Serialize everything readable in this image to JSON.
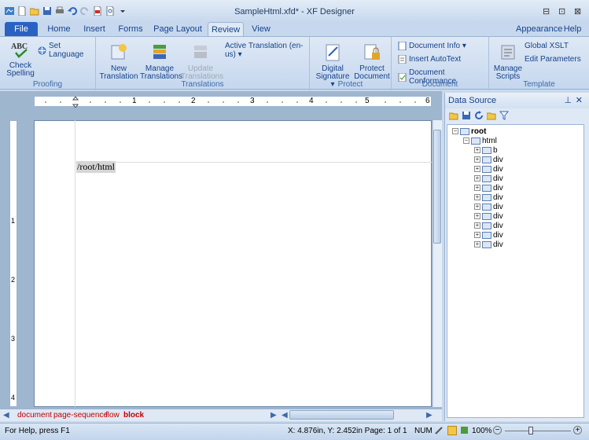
{
  "window": {
    "title": "SampleHtml.xfd* - XF Designer",
    "minimize": "⊟",
    "restore": "⊡",
    "close": "⊠"
  },
  "tabs": [
    {
      "label": "File"
    },
    {
      "label": "Home"
    },
    {
      "label": "Insert"
    },
    {
      "label": "Forms"
    },
    {
      "label": "Page Layout"
    },
    {
      "label": "Review"
    },
    {
      "label": "View"
    }
  ],
  "right_menus": {
    "appearance": "Appearance ▾",
    "help": "Help ▾"
  },
  "ribbon": {
    "proofing": {
      "label": "Proofing",
      "check_spelling_1": "Check",
      "check_spelling_2": "Spelling",
      "set_language": "Set Language"
    },
    "translations": {
      "label": "Translations",
      "new_1": "New",
      "new_2": "Translation",
      "manage_1": "Manage",
      "manage_2": "Translations",
      "update_1": "Update",
      "update_2": "Translations",
      "active": "Active Translation (en-us) ▾"
    },
    "protect": {
      "label": "Protect",
      "digital_1": "Digital",
      "digital_2": "Signature ▾",
      "protect_1": "Protect",
      "protect_2": "Document"
    },
    "document": {
      "label": "Document",
      "info": "Document Info ▾",
      "autotext": "Insert AutoText",
      "conformance": "Document Conformance"
    },
    "template": {
      "label": "Template",
      "scripts_1": "Manage",
      "scripts_2": "Scripts",
      "global_xslt": "Global XSLT",
      "edit_params": "Edit Parameters"
    }
  },
  "ruler": {
    "numbers": [
      "1",
      "2",
      "3",
      "4",
      "5",
      "6"
    ],
    "vnumbers": [
      "1",
      "2",
      "3",
      "4"
    ]
  },
  "document": {
    "block_text": "/root/html"
  },
  "breadcrumbs": [
    "document",
    "page-sequence",
    "flow",
    "block"
  ],
  "datasource": {
    "title": "Data Source",
    "pin": "⊥",
    "close": "✕",
    "tree": [
      {
        "label": "root",
        "expander": "−",
        "bold": true
      },
      {
        "label": "html",
        "expander": "−"
      },
      {
        "label": "b",
        "expander": "+"
      },
      {
        "label": "div",
        "expander": "+"
      },
      {
        "label": "div",
        "expander": "+"
      },
      {
        "label": "div",
        "expander": "+"
      },
      {
        "label": "div",
        "expander": "+"
      },
      {
        "label": "div",
        "expander": "+"
      },
      {
        "label": "div",
        "expander": "+"
      },
      {
        "label": "div",
        "expander": "+"
      },
      {
        "label": "div",
        "expander": "+"
      },
      {
        "label": "div",
        "expander": "+"
      },
      {
        "label": "div",
        "expander": "+"
      }
    ]
  },
  "status": {
    "help": "For Help, press F1",
    "position": "X: 4.876in, Y: 2.452in Page: 1 of 1",
    "num": "NUM",
    "zoom": "100%"
  },
  "colors": {
    "file_tab": "#2a62c2",
    "crumb": "#c00000",
    "accent": "#15428b"
  }
}
